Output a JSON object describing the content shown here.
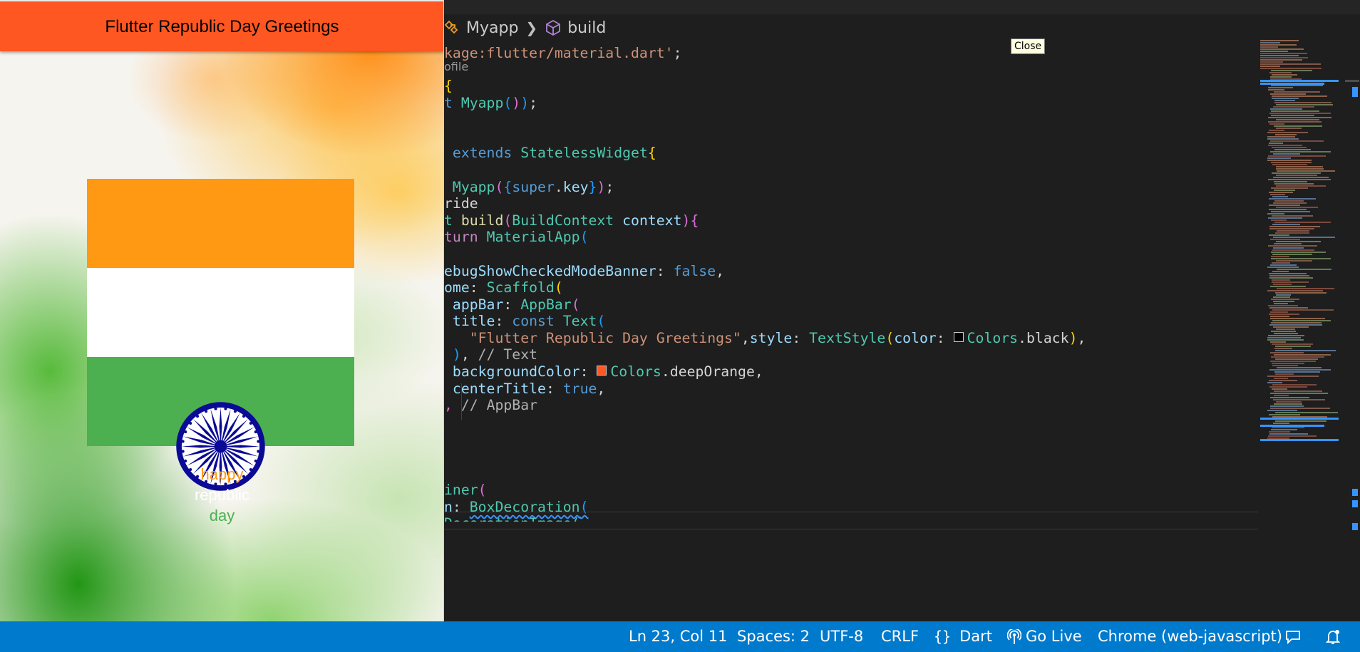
{
  "colors": {
    "editor_bg": "#1e1e1e",
    "statusbar_bg": "#007acc",
    "appbar_bg": "#ff5722",
    "saffron": "#ff9914",
    "white": "#ffffff",
    "green": "#4caf50",
    "chakra_blue": "#0a0a96"
  },
  "app": {
    "title": "Flutter Republic Day Greetings",
    "greeting_lines": [
      "happy",
      "republic",
      "day"
    ],
    "greeting_colors": [
      "#ff9914",
      "#ffffff",
      "#4caf50"
    ]
  },
  "editor": {
    "breadcrumb": [
      {
        "label": "Myapp",
        "icon": "class-icon"
      },
      {
        "label": "build",
        "icon": "cube-method-icon"
      }
    ],
    "codelens": "ofile",
    "tooltip": "Close",
    "code": {
      "import_text": "kage:flutter/material.dart'",
      "main_open": "{",
      "run_prefix": "t ",
      "run_class": "Myapp",
      "extends_kw": "extends",
      "base_class": "StatelessWidget",
      "ctor_name": "Myapp",
      "ctor_param": "super",
      "ctor_key": "key",
      "override": "ride",
      "build_prefix": "t ",
      "build_name": "build",
      "build_param_type": "BuildContext",
      "build_param": "context",
      "return_kw": "turn",
      "material_app": "MaterialApp",
      "debug_prop": "ebugShowCheckedModeBanner",
      "false_kw": "false",
      "home_prop": "ome",
      "scaffold": "Scaffold",
      "appbar_prop": "appBar",
      "appbar_cls": "AppBar",
      "title_prop": "title",
      "const_kw": "const",
      "text_cls": "Text",
      "title_string": "\"Flutter Republic Day Greetings\"",
      "style_prop": "style",
      "textstyle_cls": "TextStyle",
      "color_prop": "color",
      "colors_cls": "Colors",
      "black": "black",
      "text_close_comment": "// Text",
      "bgcolor_prop": "backgroundColor",
      "deep_orange": "deepOrange",
      "center_prop": "centerTitle",
      "true_kw": "true",
      "appbar_comment": "// AppBar",
      "container_fragment": "iner",
      "decoration_prop": "n",
      "boxdecoration_cls": "BoxDecoration",
      "next_fragment": "DecorationImage("
    }
  },
  "statusbar": {
    "position": "Ln 23, Col 11",
    "spaces": "Spaces: 2",
    "encoding": "UTF-8",
    "eol": "CRLF",
    "language": "Dart",
    "golive": "Go Live",
    "device": "Chrome (web-javascript)"
  }
}
